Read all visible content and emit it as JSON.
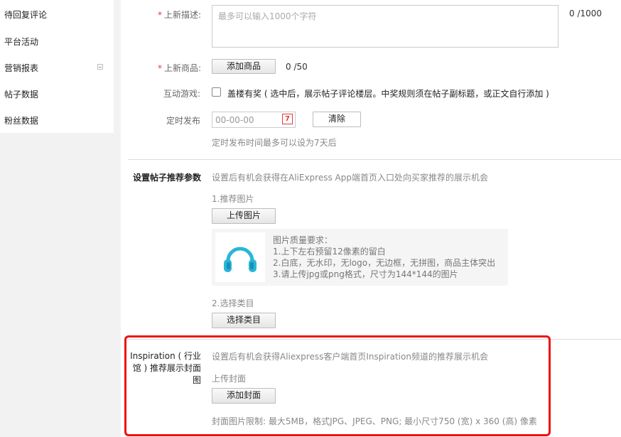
{
  "sidebar": {
    "items": [
      {
        "label": "待回复评论"
      },
      {
        "label": "平台活动"
      },
      {
        "label": "营销报表"
      },
      {
        "label": "帖子数据"
      },
      {
        "label": "粉丝数据"
      }
    ]
  },
  "form": {
    "description": {
      "required_mark": "*",
      "label": "上新描述:",
      "placeholder": "最多可以输入1000个字符",
      "count": "0",
      "max": "/1000"
    },
    "products": {
      "required_mark": "*",
      "label": "上新商品:",
      "button": "添加商品",
      "count": "0",
      "max": "/50"
    },
    "game": {
      "label": "互动游戏:",
      "checkbox_label": "盖楼有奖",
      "checkbox_note": "( 选中后，展示帖子评论楼层。中奖规则须在帖子副标题，或正文自行添加 )"
    },
    "schedule": {
      "label": "定时发布",
      "placeholder": "00-00-00",
      "calendar_glyph": "7",
      "clear_button": "清除",
      "hint": "定时发布时间最多可以设为7天后"
    }
  },
  "recommend": {
    "title": "设置帖子推荐参数",
    "desc": "设置后有机会获得在AliExpress App端首页入口处向买家推荐的展示机会",
    "step1": "1.推荐图片",
    "upload_button": "上传图片",
    "requirements": {
      "title": "图片质量要求：",
      "lines": [
        "1.上下左右预留12像素的留白",
        "2.白底，无水印，无logo，无边框，无拼图，商品主体突出",
        "3.请上传jpg或png格式，尺寸为144*144的图片"
      ]
    },
    "step2": "2.选择类目",
    "category_button": "选择类目"
  },
  "inspiration": {
    "title": "Inspiration ( 行业馆 ) 推荐展示封面图",
    "title_lines": [
      "Inspiration ( 行业",
      "馆 ) 推荐展示封面",
      "图"
    ],
    "desc": "设置后有机会获得Aliexpress客户端首页Inspiration频道的推荐展示机会",
    "cover_label": "上传封面",
    "cover_button": "添加封面",
    "limit": "封面图片限制: 最大5MB，格式JPG、JPEG、PNG; 最小尺寸750 (宽) x 360 (高) 像素"
  },
  "colors": {
    "accent_red": "#e11111",
    "required_red": "#e4393c",
    "headphone_cyan": "#29b6d8"
  },
  "icons": [
    "collapse-icon",
    "calendar-icon",
    "headphones-image"
  ]
}
